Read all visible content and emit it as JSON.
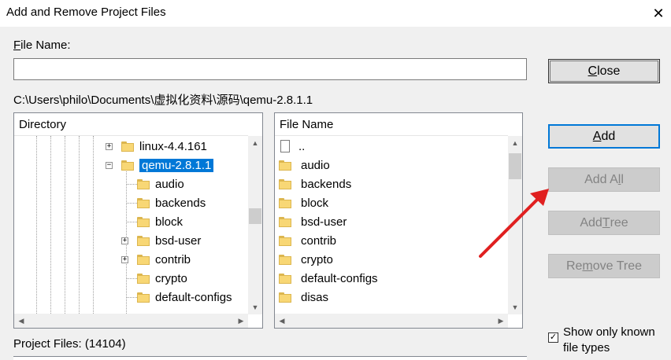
{
  "window": {
    "title": "Add and Remove Project Files"
  },
  "file_name": {
    "label_u": "F",
    "label_rest": "ile Name:",
    "value": ""
  },
  "path": "C:\\Users\\philo\\Documents\\虚拟化资料\\源码\\qemu-2.8.1.1",
  "directory_pane": {
    "header": "Directory",
    "items": [
      {
        "label": "linux-4.4.161",
        "expander": "+"
      },
      {
        "label": "qemu-2.8.1.1",
        "expander": "−",
        "selected": true
      },
      {
        "label": "audio"
      },
      {
        "label": "backends"
      },
      {
        "label": "block"
      },
      {
        "label": "bsd-user",
        "expander": "+"
      },
      {
        "label": "contrib",
        "expander": "+"
      },
      {
        "label": "crypto"
      },
      {
        "label": "default-configs"
      }
    ]
  },
  "files_pane": {
    "header": "File Name",
    "items": [
      {
        "label": "..",
        "icon": "file-icon"
      },
      {
        "label": "audio",
        "icon": "folder-icon"
      },
      {
        "label": "backends",
        "icon": "folder-icon"
      },
      {
        "label": "block",
        "icon": "folder-icon"
      },
      {
        "label": "bsd-user",
        "icon": "folder-icon"
      },
      {
        "label": "contrib",
        "icon": "folder-icon"
      },
      {
        "label": "crypto",
        "icon": "folder-icon"
      },
      {
        "label": "default-configs",
        "icon": "folder-icon"
      },
      {
        "label": "disas",
        "icon": "folder-icon"
      }
    ]
  },
  "buttons": {
    "close": {
      "u": "C",
      "rest": "lose"
    },
    "add": {
      "u": "A",
      "rest": "dd"
    },
    "add_all": {
      "pre": "Add A",
      "u": "l",
      "rest": "l",
      "disabled": true
    },
    "add_tree": {
      "pre": "Add ",
      "u": "T",
      "rest": "ree",
      "disabled": true
    },
    "remove_tree": {
      "pre": "Re",
      "u": "m",
      "rest": "ove Tree",
      "disabled": true
    }
  },
  "project_files": {
    "label": "Project Files: (14104)"
  },
  "show_known": {
    "checked": true,
    "line1": "Show only known",
    "line2": "file types",
    "check_glyph": "✓"
  },
  "colors": {
    "selection": "#0078d7",
    "annotation_arrow": "#e02020"
  }
}
